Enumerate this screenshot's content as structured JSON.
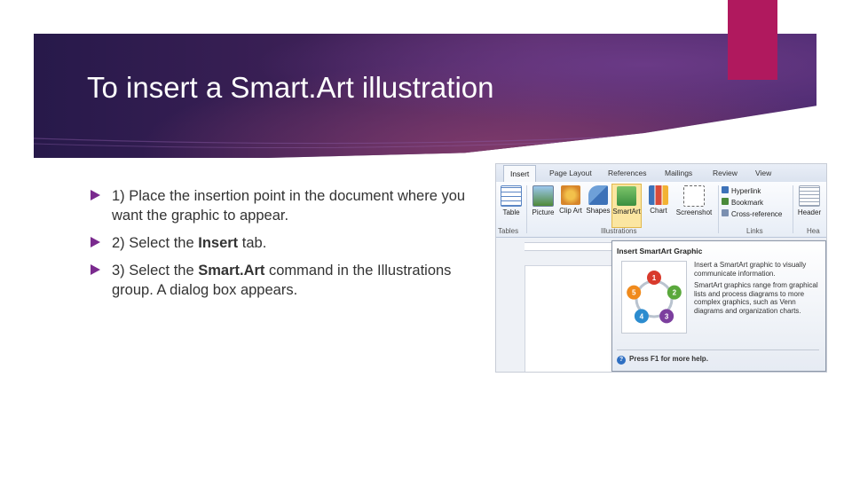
{
  "slide": {
    "title": "To insert a Smart.Art illustration",
    "accent_color": "#b0195e",
    "bullet_color": "#7a2a8e"
  },
  "bullets": [
    {
      "text": "1) Place the insertion point in the document where you want the graphic to appear."
    },
    {
      "pre": "2) Select the ",
      "bold": "Insert",
      "post": " tab."
    },
    {
      "pre": "3) Select the ",
      "bold": "Smart.Art",
      "post": " command in the Illustrations group. A dialog box appears."
    }
  ],
  "screenshot": {
    "tabs": [
      "Insert",
      "Page Layout",
      "References",
      "Mailings",
      "Review",
      "View"
    ],
    "buttons": [
      "Table",
      "Picture",
      "Clip Art",
      "Shapes",
      "SmartArt",
      "Chart",
      "Screenshot"
    ],
    "links": [
      "Hyperlink",
      "Bookmark",
      "Cross-reference"
    ],
    "header_button": "Header",
    "groups": [
      "Tables",
      "Illustrations",
      "Links",
      "Hea"
    ],
    "tooltip": {
      "title": "Insert SmartArt Graphic",
      "desc1": "Insert a SmartArt graphic to visually communicate information.",
      "desc2": "SmartArt graphics range from graphical lists and process diagrams to more complex graphics, such as Venn diagrams and organization charts.",
      "help": "Press F1 for more help.",
      "cycle_numbers": [
        "1",
        "2",
        "3",
        "4",
        "5"
      ],
      "cycle_colors": [
        "#d83a2c",
        "#5aa83c",
        "#7c3f9e",
        "#2c8ccf",
        "#f08a1c"
      ]
    }
  }
}
